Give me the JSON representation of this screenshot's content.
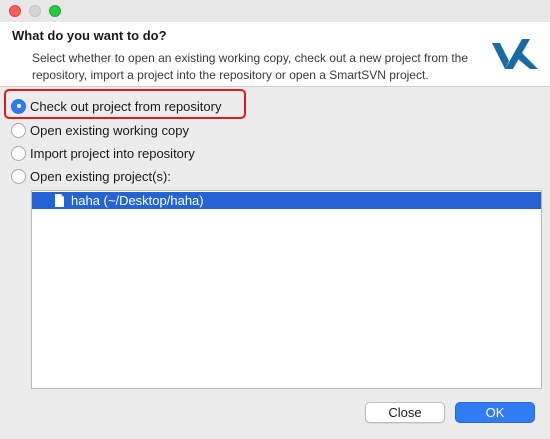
{
  "window": {
    "buttons": [
      "close",
      "minimize",
      "maximize"
    ]
  },
  "header": {
    "title": "What do you want to do?",
    "description": "Select whether to open an existing working copy, check out a new project from the repository, import a project into the repository or open a SmartSVN project."
  },
  "options": [
    {
      "label": "Check out project from repository",
      "selected": true
    },
    {
      "label": "Open existing working copy",
      "selected": false
    },
    {
      "label": "Import project into repository",
      "selected": false
    },
    {
      "label": "Open existing project(s):",
      "selected": false
    }
  ],
  "projects": [
    {
      "label": "haha (~/Desktop/haha)",
      "selected": true
    }
  ],
  "buttons": {
    "close": "Close",
    "ok": "OK"
  },
  "colors": {
    "accent": "#2f7cf6",
    "selection": "#2463d3",
    "highlight_border": "#e0171b",
    "logo": "#1a6aa8"
  }
}
